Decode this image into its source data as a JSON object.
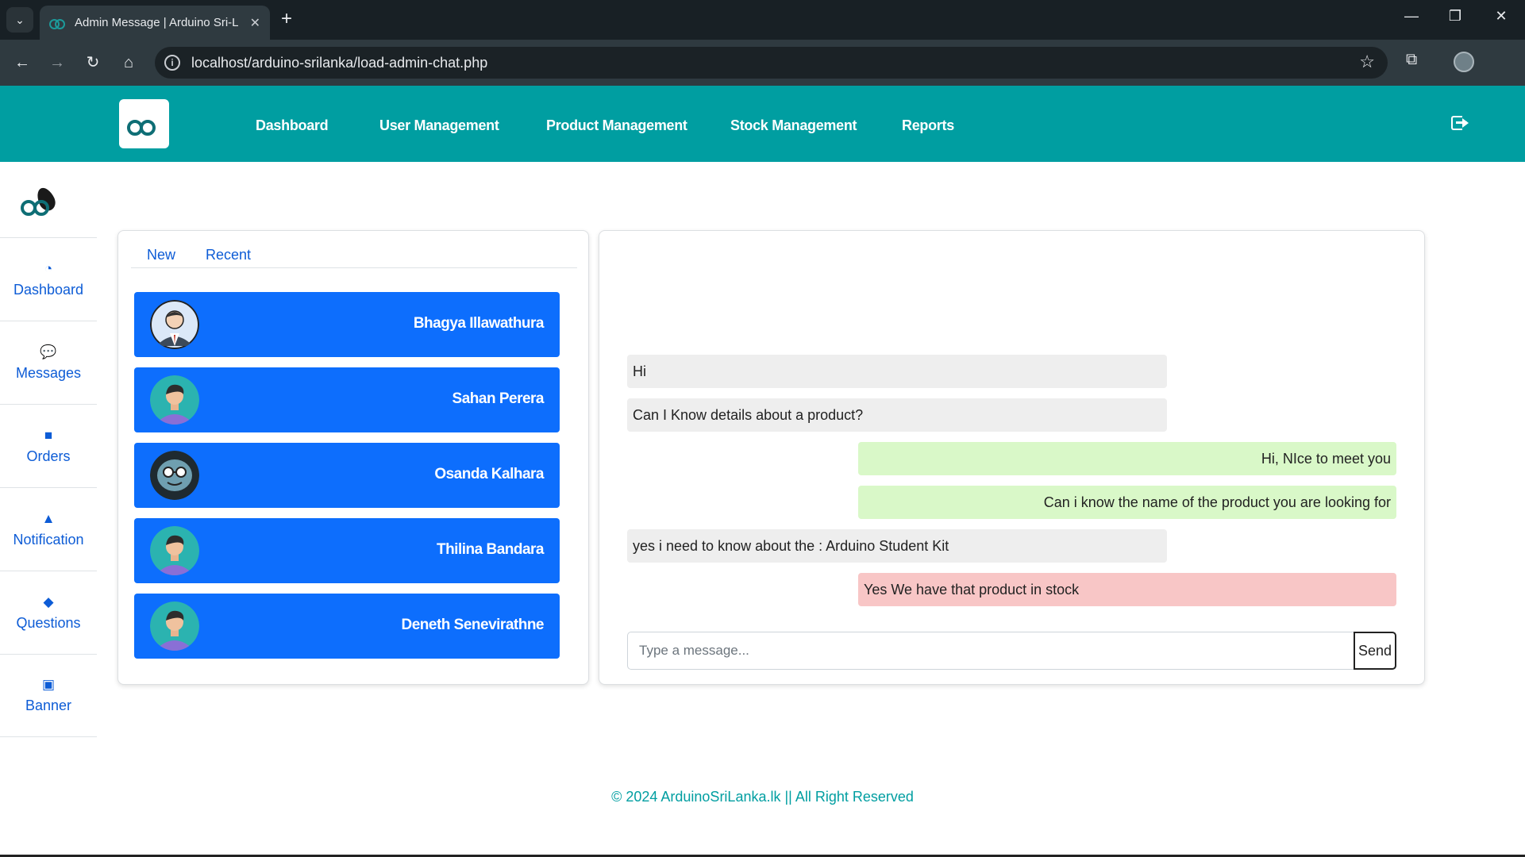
{
  "browser": {
    "tab_title": "Admin Message | Arduino Sri-L",
    "url": "localhost/arduino-srilanka/load-admin-chat.php"
  },
  "header": {
    "nav": [
      "Dashboard",
      "User Management",
      "Product Management",
      "Stock Management",
      "Reports"
    ]
  },
  "sidebar": {
    "items": [
      {
        "label": "Dashboard",
        "icon": "gauge-icon"
      },
      {
        "label": "Messages",
        "icon": "chat-icon"
      },
      {
        "label": "Orders",
        "icon": "box-icon"
      },
      {
        "label": "Notification",
        "icon": "bell-icon"
      },
      {
        "label": "Questions",
        "icon": "question-icon"
      },
      {
        "label": "Banner",
        "icon": "image-icon"
      }
    ]
  },
  "chat_list": {
    "tabs": [
      "New",
      "Recent"
    ],
    "users": [
      {
        "name": "Bhagya Illawathura",
        "avatar": "suit"
      },
      {
        "name": "Sahan Perera",
        "avatar": "person"
      },
      {
        "name": "Osanda Kalhara",
        "avatar": "cartoon"
      },
      {
        "name": "Thilina Bandara",
        "avatar": "person"
      },
      {
        "name": "Deneth Senevirathne",
        "avatar": "person"
      }
    ]
  },
  "chat": {
    "messages": [
      {
        "text": "Hi",
        "direction": "in"
      },
      {
        "text": "Can I Know details about a product?",
        "direction": "in"
      },
      {
        "text": "Hi, NIce to meet you",
        "direction": "out"
      },
      {
        "text": "Can i know the name of the product you are looking for",
        "direction": "out"
      },
      {
        "text": "yes i need to know about the : Arduino Student Kit",
        "direction": "in"
      },
      {
        "text": "Yes We have that product in stock",
        "direction": "pending"
      }
    ],
    "input_placeholder": "Type a message...",
    "send_label": "Send"
  },
  "footer": "© 2024 ArduinoSriLanka.lk || All Right Reserved",
  "colors": {
    "header": "#009ea1",
    "primary": "#0d6efd",
    "incoming": "#eeeeee",
    "outgoing": "#d9f8c8",
    "pending": "#f8c6c6"
  }
}
